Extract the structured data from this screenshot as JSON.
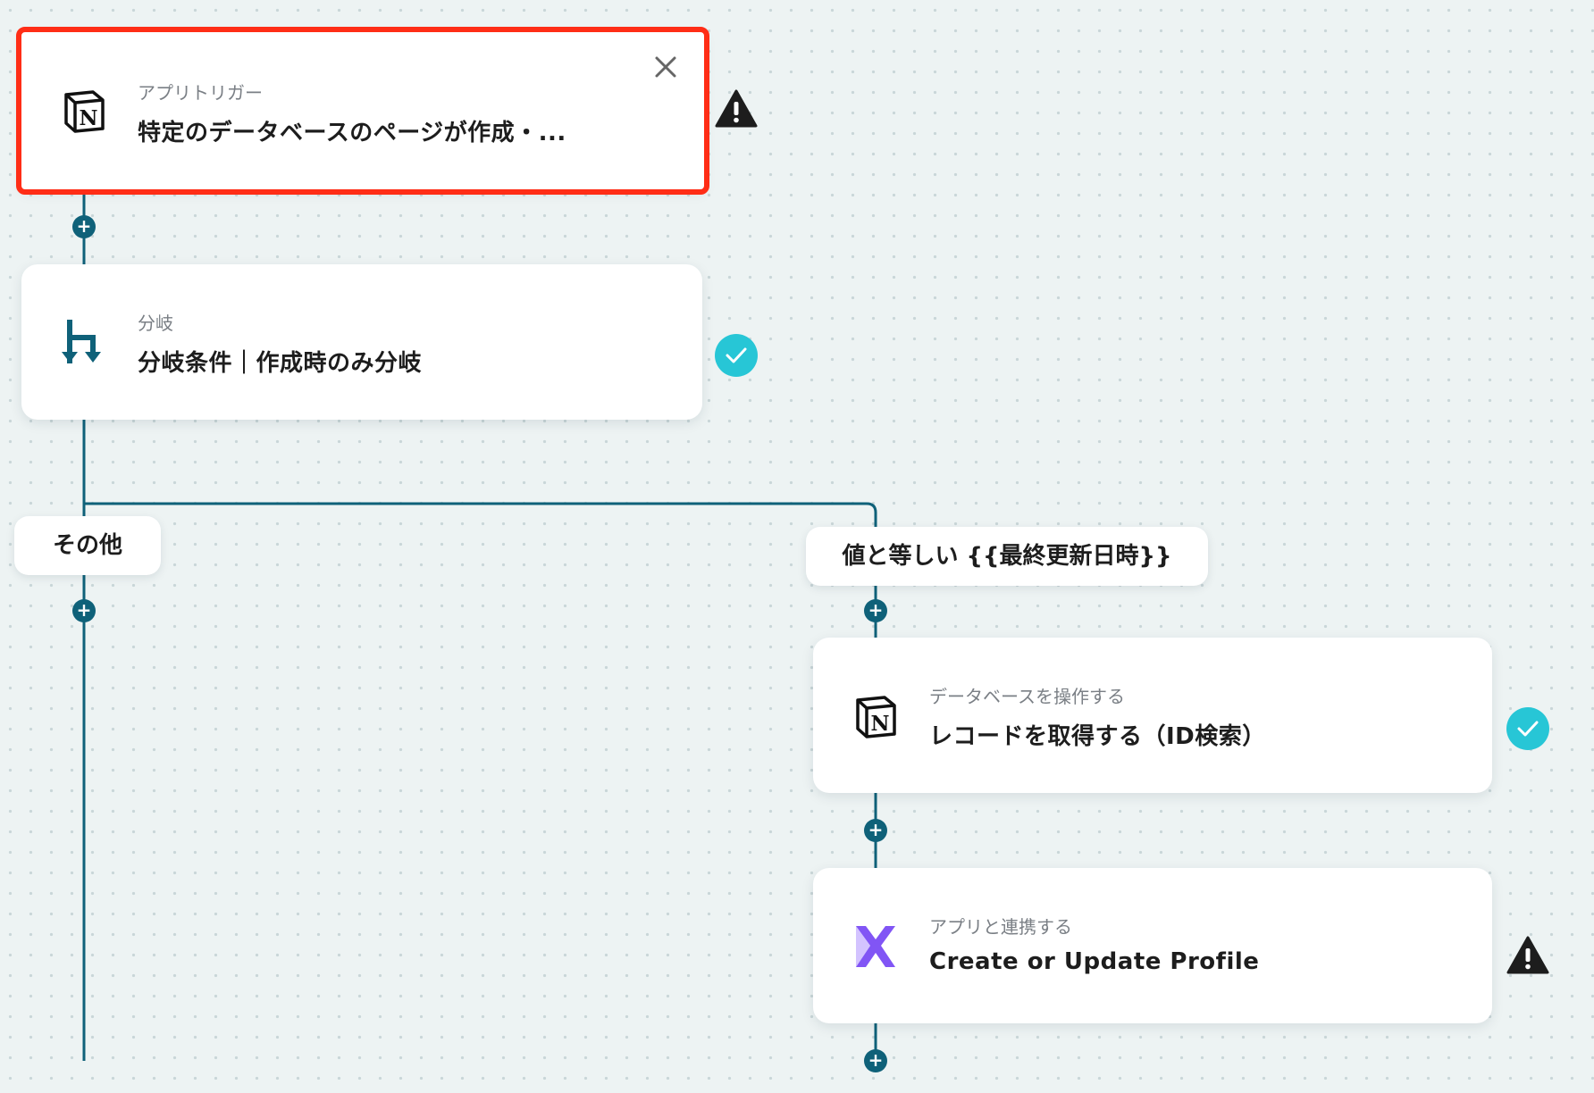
{
  "steps": {
    "trigger": {
      "subtitle": "アプリトリガー",
      "title": "特定のデータベースのページが作成・..."
    },
    "branch": {
      "subtitle": "分岐",
      "title": "分岐条件｜作成時のみ分岐"
    },
    "get_record": {
      "subtitle": "データベースを操作する",
      "title": "レコードを取得する（ID検索）"
    },
    "klaviyo": {
      "subtitle": "アプリと連携する",
      "title": "Create or Update Profile"
    }
  },
  "branches": {
    "other": "その他",
    "equals": "値と等しい {{最終更新日時}}"
  },
  "plus_symbol": "+",
  "colors": {
    "line": "#0f6179",
    "selected_border": "#ff2d16",
    "check": "#27c6d6",
    "warning": "#1d1d1d",
    "klaviyo_accent": "#8155f5",
    "branch_icon": "#0f6179"
  },
  "icons": {
    "trigger": "notion-icon",
    "branch": "branch-icon",
    "get_record": "notion-icon",
    "klaviyo": "klaviyo-icon"
  }
}
